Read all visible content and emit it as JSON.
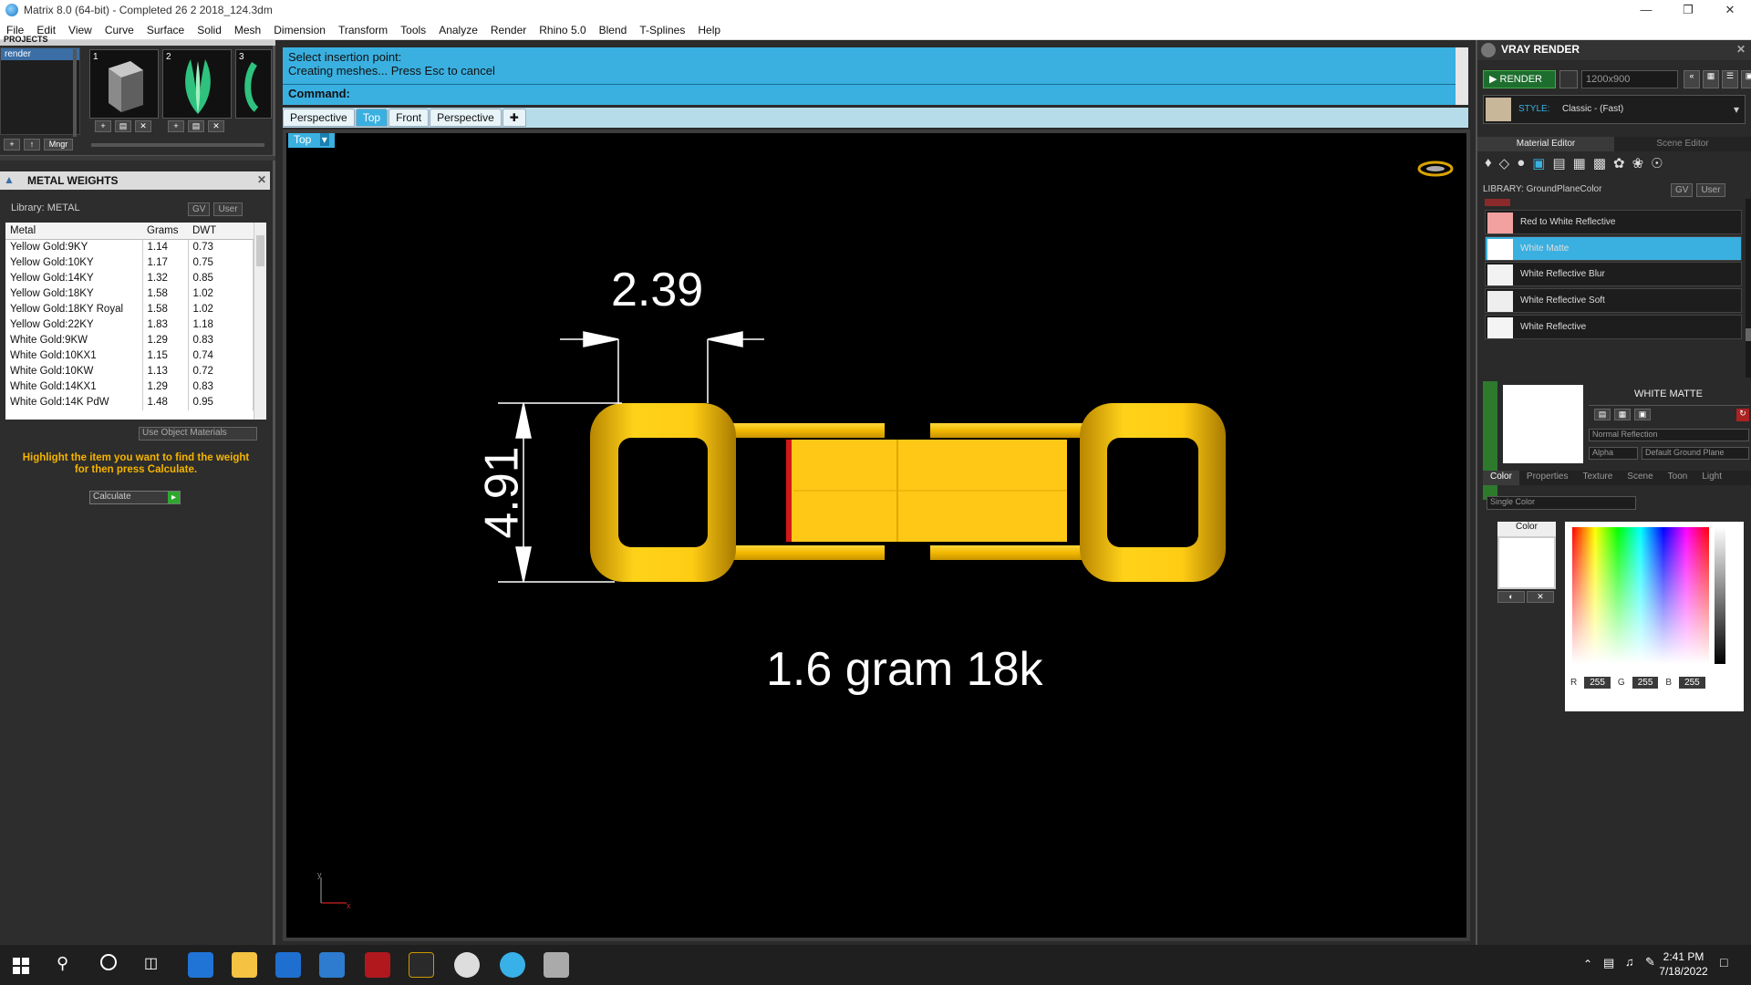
{
  "window": {
    "title": "Matrix 8.0 (64-bit) - Completed 26 2 2018_124.3dm"
  },
  "menu": [
    "File",
    "Edit",
    "View",
    "Curve",
    "Surface",
    "Solid",
    "Mesh",
    "Dimension",
    "Transform",
    "Tools",
    "Analyze",
    "Render",
    "Rhino 5.0",
    "Blend",
    "T-Splines",
    "Help"
  ],
  "projects": {
    "header": "PROJECTS",
    "selected": "render",
    "thumb_numbers": [
      "1",
      "2",
      "3"
    ],
    "mngr": "Mngr"
  },
  "metal_weights": {
    "title": "METAL WEIGHTS",
    "library": "Library: METAL",
    "gv": "GV",
    "user": "User",
    "columns": [
      "Metal",
      "Grams",
      "DWT"
    ],
    "rows": [
      [
        "Yellow Gold:9KY",
        "1.14",
        "0.73"
      ],
      [
        "Yellow Gold:10KY",
        "1.17",
        "0.75"
      ],
      [
        "Yellow Gold:14KY",
        "1.32",
        "0.85"
      ],
      [
        "Yellow Gold:18KY",
        "1.58",
        "1.02"
      ],
      [
        "Yellow Gold:18KY Royal",
        "1.58",
        "1.02"
      ],
      [
        "Yellow Gold:22KY",
        "1.83",
        "1.18"
      ],
      [
        "White Gold:9KW",
        "1.29",
        "0.83"
      ],
      [
        "White Gold:10KX1",
        "1.15",
        "0.74"
      ],
      [
        "White Gold:10KW",
        "1.13",
        "0.72"
      ],
      [
        "White Gold:14KX1",
        "1.29",
        "0.83"
      ],
      [
        "White Gold:14K PdW",
        "1.48",
        "0.95"
      ]
    ],
    "use_object_materials": "Use Object Materials",
    "hint": "Highlight the item you want to find the weight for then press Calculate.",
    "calculate": "Calculate"
  },
  "command": {
    "line1": "Select insertion point:",
    "line2": "Creating meshes... Press Esc to cancel",
    "prompt": "Command:"
  },
  "viewport_tabs": [
    "Perspective",
    "Top",
    "Front",
    "Perspective"
  ],
  "active_tab": "Top",
  "viewport_label": "Top",
  "annotations": {
    "width_dim": "2.39",
    "height_dim": "4.91",
    "weight_text": "1.6 gram 18k",
    "axis_y": "y",
    "axis_x": "x"
  },
  "vray": {
    "title": "VRAY RENDER",
    "render_btn": "RENDER",
    "resolution": "1200x900",
    "style_label": "STYLE:",
    "style_value": "Classic - (Fast)",
    "tabs": [
      "Material Editor",
      "Scene Editor"
    ],
    "library": "LIBRARY: GroundPlaneColor",
    "gv": "GV",
    "user": "User",
    "materials": [
      {
        "name": "Red to White Reflective",
        "color": "#f2a0a0"
      },
      {
        "name": "White Matte",
        "color": "#ffffff",
        "selected": true
      },
      {
        "name": "White Reflective Blur",
        "color": "#f2f2f2"
      },
      {
        "name": "White Reflective Soft",
        "color": "#eeeeee"
      },
      {
        "name": "White Reflective",
        "color": "#f4f4f4"
      }
    ],
    "preview_title": "WHITE MATTE",
    "reflection": "Normal Reflection",
    "alpha": "Alpha",
    "ground": "Default Ground Plane",
    "prop_tabs": [
      "Color",
      "Properties",
      "Texture",
      "Scene",
      "Toon",
      "Light"
    ],
    "color_mode": "Single Color",
    "color_label": "Color",
    "rgb": {
      "r": "255",
      "g": "255",
      "b": "255"
    },
    "r_label": "R",
    "g_label": "G",
    "b_label": "B"
  },
  "taskbar": {
    "time": "2:41 PM",
    "date": "7/18/2022"
  },
  "colors": {
    "accent": "#3ab0e0",
    "gold": "#f5c518",
    "selected": "#3ab0e0"
  }
}
